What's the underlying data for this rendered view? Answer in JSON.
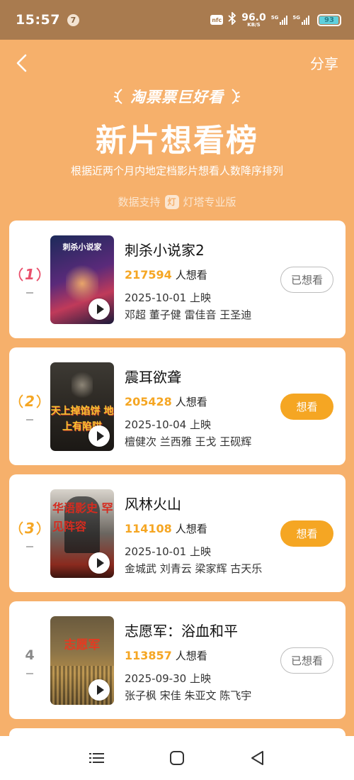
{
  "status_bar": {
    "time": "15:57",
    "notification_count": "7",
    "nfc_label": "nfc",
    "speed_value": "96.0",
    "speed_unit": "KB/S",
    "network_1": "5G",
    "network_2": "5G",
    "battery_level": "93"
  },
  "header": {
    "share_label": "分享",
    "brand": "淘票票巨好看",
    "title": "新片想看榜",
    "subtitle": "根据近两个月内地定档影片想看人数降序排列",
    "data_support_label": "数据支持",
    "data_provider": "灯塔专业版"
  },
  "movies": [
    {
      "rank": "1",
      "title": "刺杀小说家2",
      "want_count": "217594",
      "want_suffix": "人想看",
      "release": "2025-10-01 上映",
      "cast": "邓超 董子健 雷佳音 王圣迪",
      "button_label": "已想看",
      "button_state": "outline",
      "poster_text": "刺杀小说家"
    },
    {
      "rank": "2",
      "title": "震耳欲聋",
      "want_count": "205428",
      "want_suffix": "人想看",
      "release": "2025-10-04 上映",
      "cast": "檀健次 兰西雅 王戈 王砚辉",
      "button_label": "想看",
      "button_state": "filled",
      "poster_text": "天上掉馅饼 地上有陷阱"
    },
    {
      "rank": "3",
      "title": "风林火山",
      "want_count": "114108",
      "want_suffix": "人想看",
      "release": "2025-10-01 上映",
      "cast": "金城武 刘青云 梁家辉 古天乐",
      "button_label": "想看",
      "button_state": "filled",
      "poster_text": "华语影史 罕见阵容"
    },
    {
      "rank": "4",
      "title": "志愿军：浴血和平",
      "want_count": "113857",
      "want_suffix": "人想看",
      "release": "2025-09-30 上映",
      "cast": "张子枫 宋佳 朱亚文 陈飞宇",
      "button_label": "已想看",
      "button_state": "outline",
      "poster_text": "志愿军"
    }
  ],
  "colors": {
    "page_bg": "#f6b06b",
    "status_bg": "#a97b4f",
    "accent": "#f5a623",
    "rank_1": "#e94f6b",
    "rank_2": "#f5a623",
    "rank_3": "#f5a623"
  },
  "icons": {
    "back": "chevron-left-icon",
    "play": "play-icon",
    "nav_menu": "menu-icon",
    "nav_home": "home-square-icon",
    "nav_back": "triangle-back-icon"
  }
}
